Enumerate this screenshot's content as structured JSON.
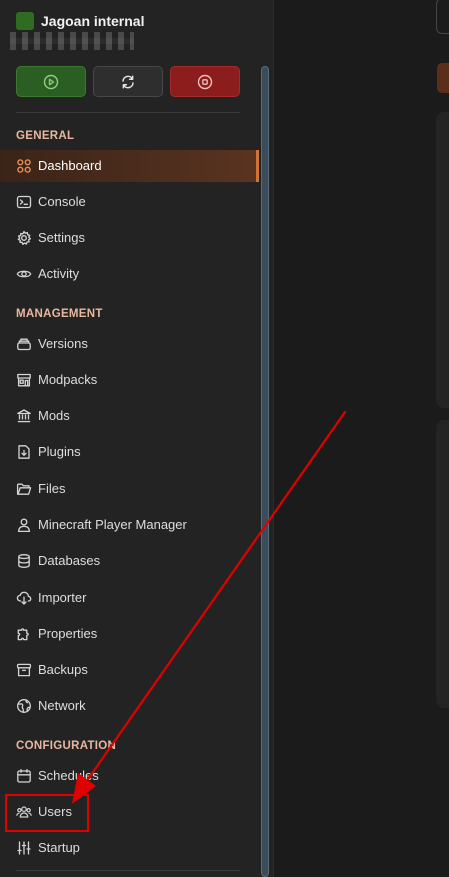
{
  "server": {
    "name": "Jagoan internal"
  },
  "power": {
    "start_icon": "play-circle-icon",
    "restart_icon": "refresh-icon",
    "stop_icon": "stop-circle-icon"
  },
  "sections": {
    "general": "GENERAL",
    "management": "MANAGEMENT",
    "configuration": "CONFIGURATION"
  },
  "nav": {
    "general": [
      {
        "label": "Dashboard",
        "icon": "dashboard-grid-icon",
        "active": true
      },
      {
        "label": "Console",
        "icon": "terminal-icon"
      },
      {
        "label": "Settings",
        "icon": "gear-icon"
      },
      {
        "label": "Activity",
        "icon": "eye-icon"
      }
    ],
    "management": [
      {
        "label": "Versions",
        "icon": "layers-icon"
      },
      {
        "label": "Modpacks",
        "icon": "store-icon"
      },
      {
        "label": "Mods",
        "icon": "building-columns-icon"
      },
      {
        "label": "Plugins",
        "icon": "file-download-icon"
      },
      {
        "label": "Files",
        "icon": "folder-icon"
      },
      {
        "label": "Minecraft Player Manager",
        "icon": "user-icon"
      },
      {
        "label": "Databases",
        "icon": "database-icon"
      },
      {
        "label": "Importer",
        "icon": "cloud-download-icon"
      },
      {
        "label": "Properties",
        "icon": "puzzle-icon"
      },
      {
        "label": "Backups",
        "icon": "archive-icon"
      },
      {
        "label": "Network",
        "icon": "globe-icon"
      }
    ],
    "configuration": [
      {
        "label": "Schedules",
        "icon": "calendar-icon"
      },
      {
        "label": "Users",
        "icon": "users-icon"
      },
      {
        "label": "Startup",
        "icon": "sliders-icon"
      }
    ]
  },
  "colors": {
    "accent": "#d1743a",
    "annotation": "#e10000",
    "start": "#2b5e22",
    "stop": "#8b1d1d"
  }
}
